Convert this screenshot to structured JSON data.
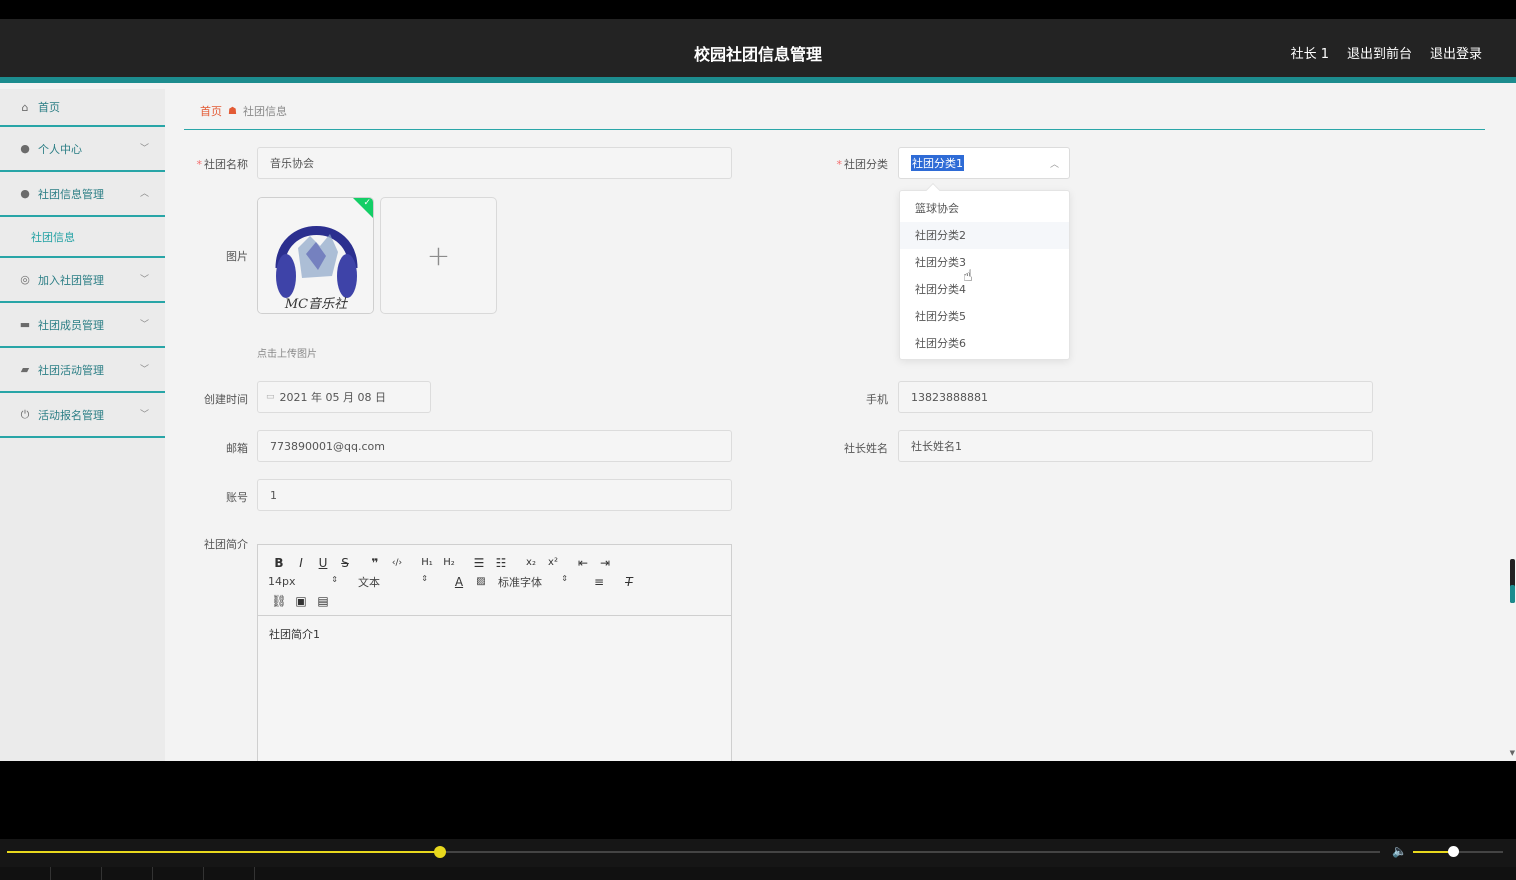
{
  "header": {
    "title": "校园社团信息管理",
    "user": "社长 1",
    "front_link": "退出到前台",
    "logout": "退出登录"
  },
  "sidebar": {
    "items": [
      {
        "label": "首页",
        "icon": "home-icon"
      },
      {
        "label": "个人中心",
        "icon": "user-icon"
      },
      {
        "label": "社团信息管理",
        "icon": "user-icon",
        "sub": "社团信息"
      },
      {
        "label": "加入社团管理",
        "icon": "circle-icon"
      },
      {
        "label": "社团成员管理",
        "icon": "briefcase-icon"
      },
      {
        "label": "社团活动管理",
        "icon": "wallet-icon"
      },
      {
        "label": "活动报名管理",
        "icon": "power-icon"
      }
    ]
  },
  "breadcrumb": {
    "home": "首页",
    "current": "社团信息"
  },
  "form": {
    "name_label": "社团名称",
    "name_value": "音乐协会",
    "category_label": "社团分类",
    "category_value": "社团分类1",
    "image_label": "图片",
    "upload_hint": "点击上传图片",
    "image_watermark": "MC音乐社",
    "created_label": "创建时间",
    "created_value": "2021 年 05 月 08 日",
    "phone_label": "手机",
    "phone_value": "13823888881",
    "email_label": "邮箱",
    "email_value": "773890001@qq.com",
    "leader_label": "社长姓名",
    "leader_value": "社长姓名1",
    "account_label": "账号",
    "account_value": "1",
    "intro_label": "社团简介",
    "intro_value": "社团简介1"
  },
  "dropdown": {
    "options": [
      "篮球协会",
      "社团分类2",
      "社团分类3",
      "社团分类4",
      "社团分类5",
      "社团分类6"
    ]
  },
  "editor": {
    "font_size": "14px",
    "text_type": "文本",
    "font_family": "标准字体"
  },
  "colors": {
    "accent": "#1c8c8e",
    "header_bg": "#232323",
    "selection": "#2e6bd6",
    "seek": "#e8d81d"
  },
  "player": {
    "progress": 0.29,
    "volume": 0.45
  }
}
